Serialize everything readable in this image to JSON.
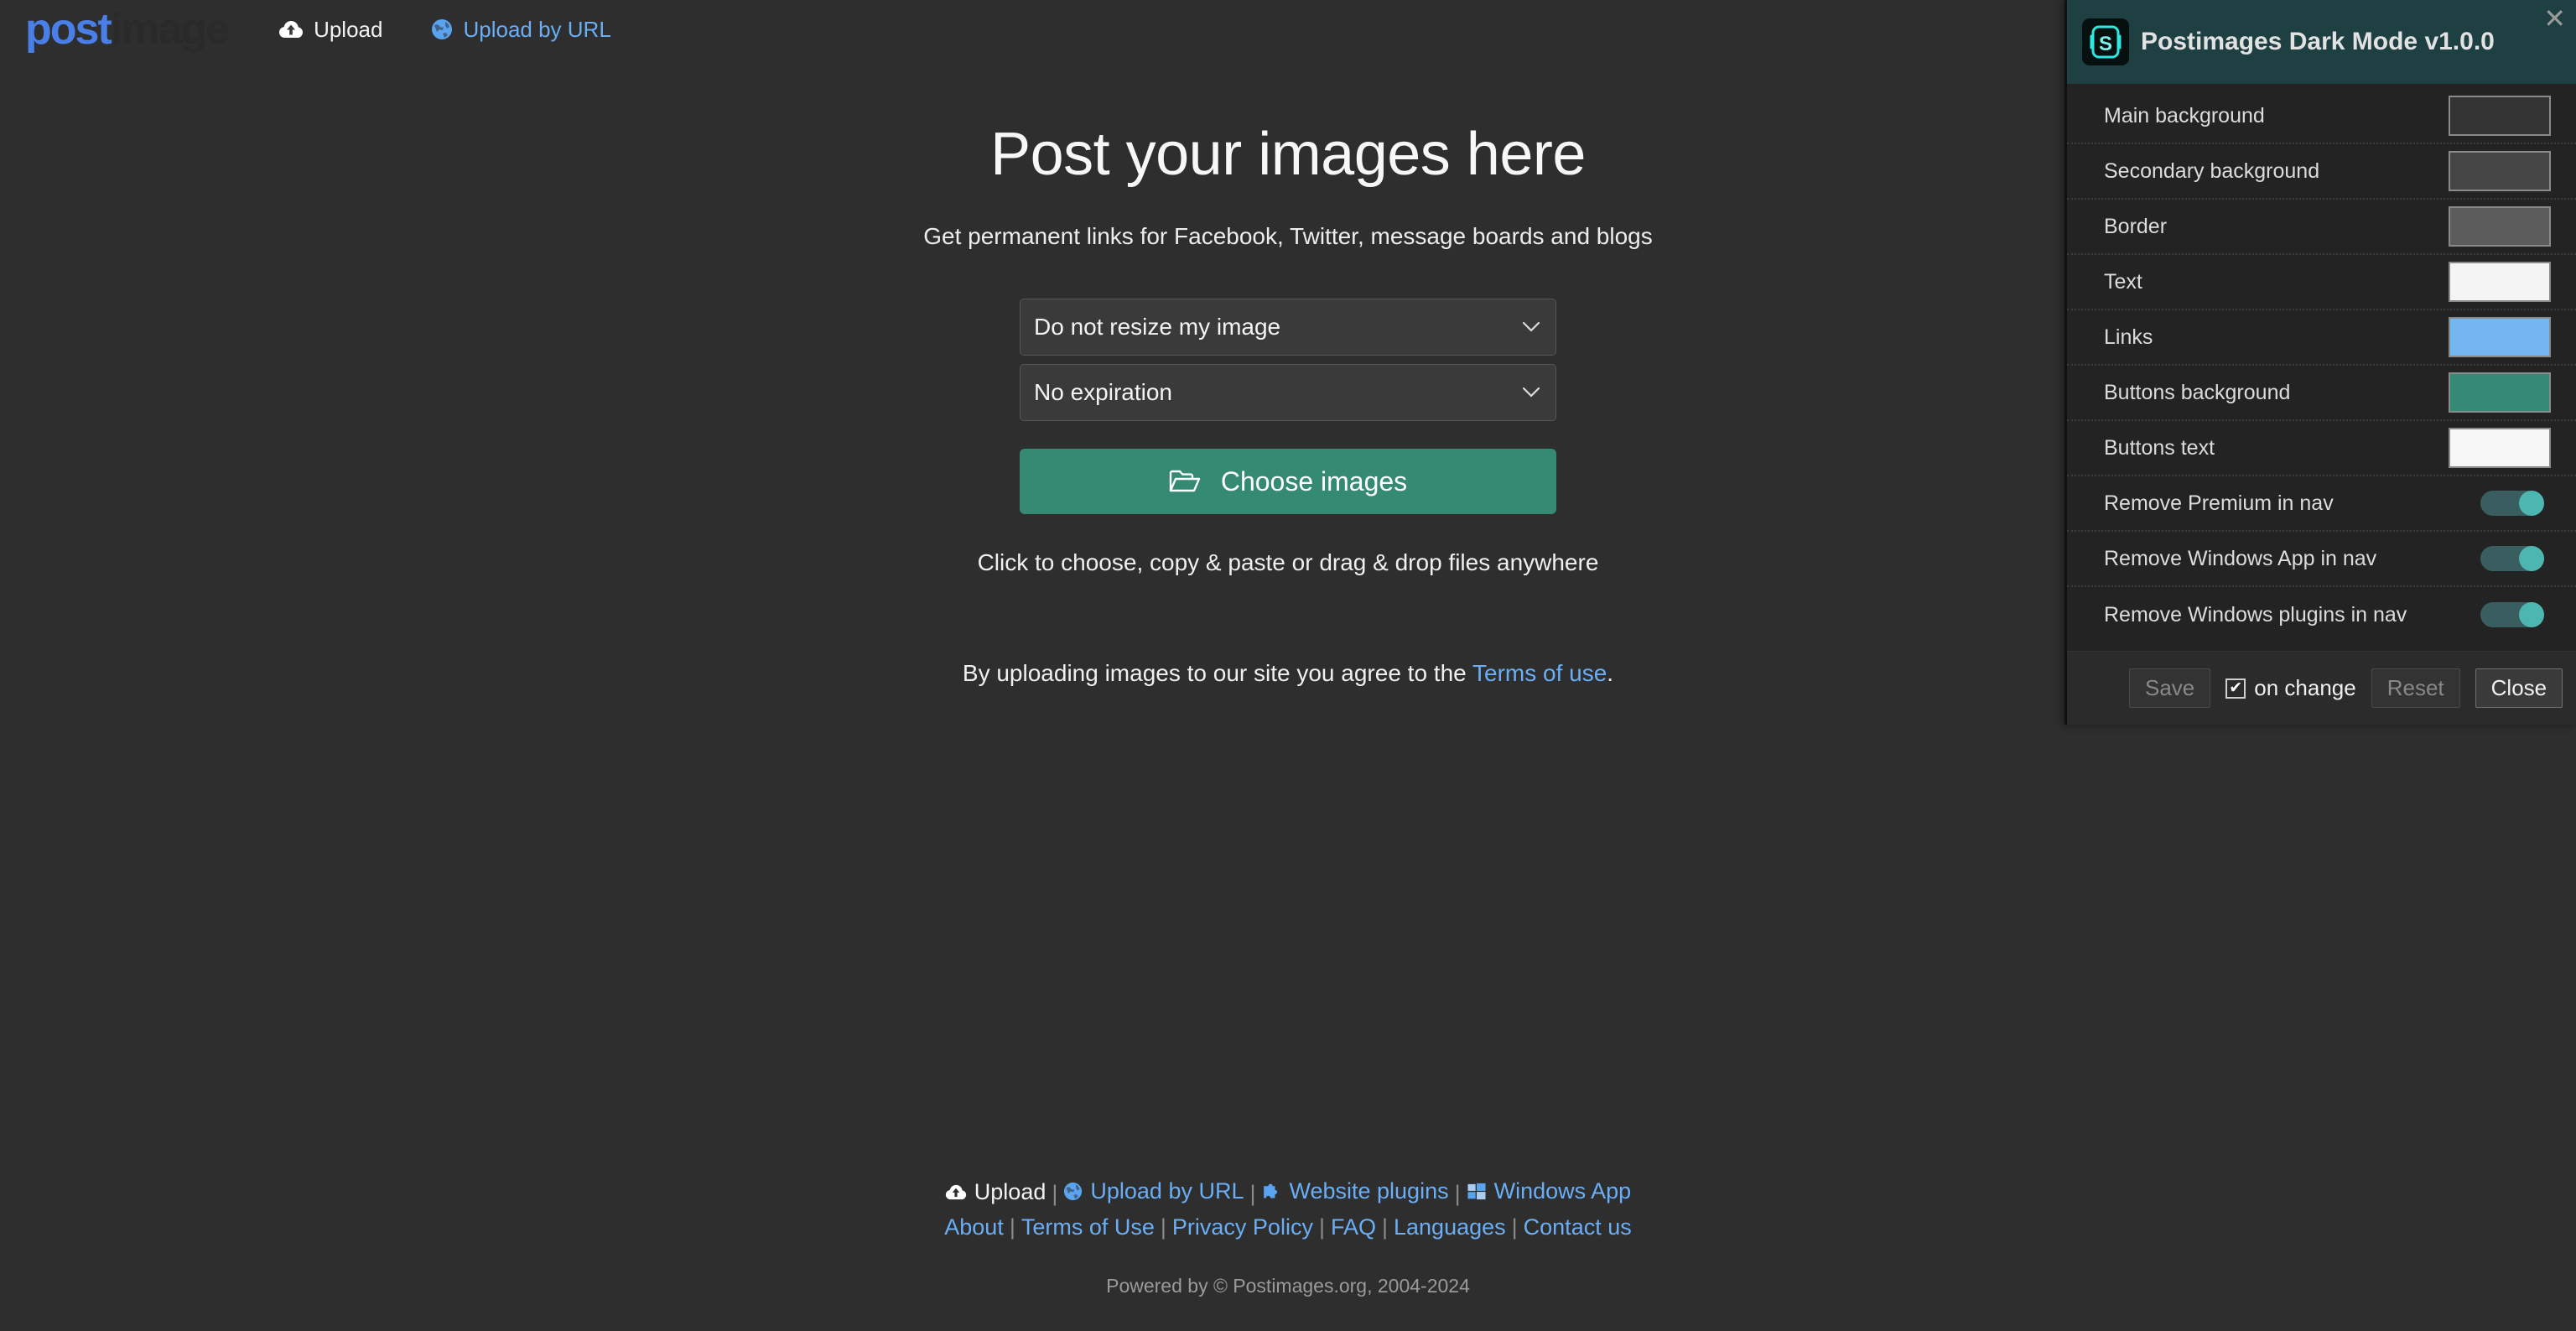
{
  "site": {
    "logo_post": "post",
    "logo_image": "image",
    "nav": [
      {
        "label": "Upload",
        "icon": "cloud-upload-icon",
        "style": "white"
      },
      {
        "label": "Upload by URL",
        "icon": "globe-icon",
        "style": "blue"
      }
    ]
  },
  "main": {
    "headline": "Post your images here",
    "subhead": "Get permanent links for Facebook, Twitter, message boards and blogs",
    "resize_select": "Do not resize my image",
    "expiration_select": "No expiration",
    "choose_button": "Choose images",
    "hint": "Click to choose, copy & paste or drag & drop files anywhere",
    "terms_prefix": "By uploading images to our site you agree to the ",
    "terms_link": "Terms of use",
    "terms_suffix": "."
  },
  "footer": {
    "row1": [
      {
        "label": "Upload",
        "icon": "cloud-upload-icon",
        "style": "white"
      },
      {
        "label": "Upload by URL",
        "icon": "globe-icon",
        "style": "blue"
      },
      {
        "label": "Website plugins",
        "icon": "puzzle-icon",
        "style": "blue"
      },
      {
        "label": "Windows App",
        "icon": "windows-icon",
        "style": "blue"
      }
    ],
    "row2": [
      "About",
      "Terms of Use",
      "Privacy Policy",
      "FAQ",
      "Languages",
      "Contact us"
    ],
    "separator": "|",
    "copyright": "Powered by © Postimages.org, 2004-2024"
  },
  "panel": {
    "title": "Postimages Dark Mode v1.0.0",
    "logo_letter": "S",
    "close_glyph": "✕",
    "color_rows": [
      {
        "label": "Main background",
        "color": "#333333"
      },
      {
        "label": "Secondary background",
        "color": "#454545"
      },
      {
        "label": "Border",
        "color": "#5c5c5c"
      },
      {
        "label": "Text",
        "color": "#f4f4f4"
      },
      {
        "label": "Links",
        "color": "#74b7f0"
      },
      {
        "label": "Buttons background",
        "color": "#348a74"
      },
      {
        "label": "Buttons text",
        "color": "#f6f6f6"
      }
    ],
    "toggle_rows": [
      {
        "label": "Remove Premium in nav",
        "on": true
      },
      {
        "label": "Remove Windows App in nav",
        "on": true
      },
      {
        "label": "Remove Windows plugins in nav",
        "on": true
      }
    ],
    "footer": {
      "save": "Save",
      "on_change": "on change",
      "on_change_checked": true,
      "check_glyph": "✔",
      "reset": "Reset",
      "close": "Close"
    },
    "accent": "#1e4043",
    "logo_cyan": "#2ee8e0"
  }
}
